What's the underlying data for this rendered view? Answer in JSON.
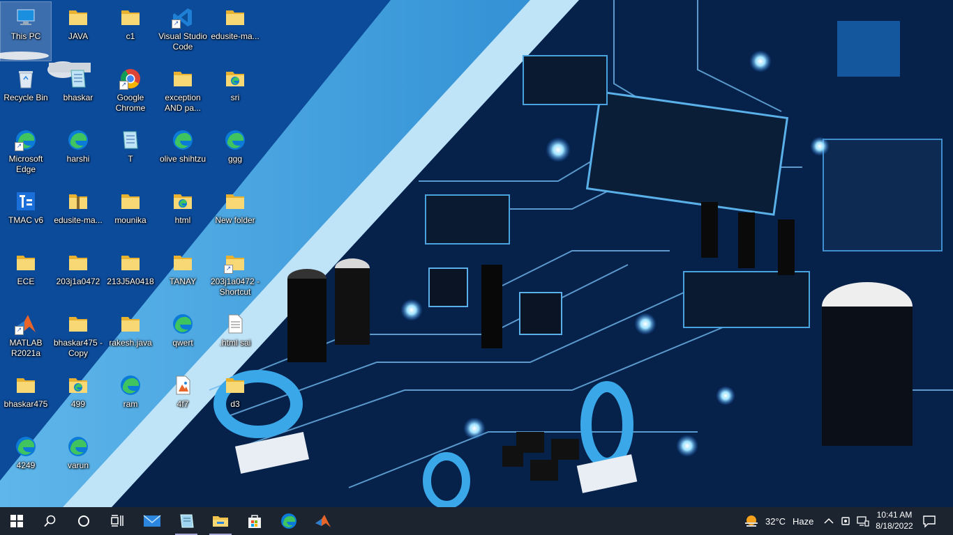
{
  "desktop": {
    "icons": [
      {
        "label": "This PC",
        "icon": "computer-icon",
        "shortcut": false
      },
      {
        "label": "JAVA",
        "icon": "folder-icon",
        "shortcut": false
      },
      {
        "label": "c1",
        "icon": "folder-icon",
        "shortcut": false
      },
      {
        "label": "Visual Studio Code",
        "icon": "vscode-icon",
        "shortcut": true
      },
      {
        "label": "edusite-ma...",
        "icon": "folder-icon",
        "shortcut": false
      },
      {
        "label": "Recycle Bin",
        "icon": "recycle-bin-icon",
        "shortcut": false
      },
      {
        "label": "bhaskar",
        "icon": "notepad-file-icon",
        "shortcut": false
      },
      {
        "label": "Google Chrome",
        "icon": "chrome-icon",
        "shortcut": true
      },
      {
        "label": "exception AND pa...",
        "icon": "folder-icon",
        "shortcut": false
      },
      {
        "label": "sri",
        "icon": "edge-folder-icon",
        "shortcut": false
      },
      {
        "label": "Microsoft Edge",
        "icon": "edge-icon",
        "shortcut": true
      },
      {
        "label": "harshi",
        "icon": "edge-icon",
        "shortcut": false
      },
      {
        "label": "T",
        "icon": "notepad-file-icon",
        "shortcut": false
      },
      {
        "label": "olive shihtzu",
        "icon": "edge-icon",
        "shortcut": false
      },
      {
        "label": "ggg",
        "icon": "edge-icon",
        "shortcut": false
      },
      {
        "label": "TMAC v6",
        "icon": "tmac-icon",
        "shortcut": false
      },
      {
        "label": "edusite-ma...",
        "icon": "zip-folder-icon",
        "shortcut": false
      },
      {
        "label": "mounika",
        "icon": "folder-icon",
        "shortcut": false
      },
      {
        "label": "html",
        "icon": "edge-folder-icon",
        "shortcut": false
      },
      {
        "label": "New folder",
        "icon": "folder-icon",
        "shortcut": false
      },
      {
        "label": "ECE",
        "icon": "folder-icon",
        "shortcut": false
      },
      {
        "label": "203j1a0472",
        "icon": "folder-icon",
        "shortcut": false
      },
      {
        "label": "213J5A0418",
        "icon": "folder-icon",
        "shortcut": false
      },
      {
        "label": "TANAY",
        "icon": "folder-icon",
        "shortcut": false
      },
      {
        "label": "203j1a0472 - Shortcut",
        "icon": "folder-icon",
        "shortcut": true
      },
      {
        "label": "MATLAB R2021a",
        "icon": "matlab-icon",
        "shortcut": true
      },
      {
        "label": "bhaskar475 - Copy",
        "icon": "folder-icon",
        "shortcut": false
      },
      {
        "label": "rakesh.java",
        "icon": "folder-icon",
        "shortcut": false
      },
      {
        "label": "qwert",
        "icon": "edge-icon",
        "shortcut": false
      },
      {
        "label": ".html sai",
        "icon": "text-file-icon",
        "shortcut": false
      },
      {
        "label": "bhaskar475",
        "icon": "folder-icon",
        "shortcut": false
      },
      {
        "label": "499",
        "icon": "edge-folder-icon",
        "shortcut": false
      },
      {
        "label": "ram",
        "icon": "edge-icon",
        "shortcut": false
      },
      {
        "label": "4f7",
        "icon": "image-file-icon",
        "shortcut": false
      },
      {
        "label": "d3",
        "icon": "folder-icon",
        "shortcut": false
      },
      {
        "label": "4249",
        "icon": "edge-icon",
        "shortcut": false
      },
      {
        "label": "varun",
        "icon": "edge-icon",
        "shortcut": false
      }
    ]
  },
  "taskbar": {
    "pinned": [
      {
        "name": "start-button",
        "icon": "windows-logo-icon",
        "active": false
      },
      {
        "name": "search-button",
        "icon": "search-icon",
        "active": false
      },
      {
        "name": "cortana-button",
        "icon": "cortana-circle-icon",
        "active": false
      },
      {
        "name": "task-view-button",
        "icon": "task-view-icon",
        "active": false
      },
      {
        "name": "mail-button",
        "icon": "mail-icon",
        "active": false
      },
      {
        "name": "notepad-button",
        "icon": "notepad-icon",
        "active": true
      },
      {
        "name": "file-explorer-button",
        "icon": "file-explorer-icon",
        "active": true
      },
      {
        "name": "store-button",
        "icon": "store-icon",
        "active": false
      },
      {
        "name": "edge-button",
        "icon": "edge-icon",
        "active": false
      },
      {
        "name": "matlab-button",
        "icon": "matlab-icon",
        "active": false
      }
    ],
    "weather": {
      "temp": "32°C",
      "condition": "Haze",
      "icon": "weather-haze-icon"
    },
    "tray_icons": [
      "chevron-up-icon",
      "device-icon",
      "network-icon"
    ],
    "clock": {
      "time": "10:41 AM",
      "date": "8/18/2022"
    }
  },
  "colors": {
    "taskbar_bg": "#1c2430",
    "folder": "#f3c44d",
    "edge_blue": "#0c7bd8",
    "edge_green": "#3fc45f"
  }
}
